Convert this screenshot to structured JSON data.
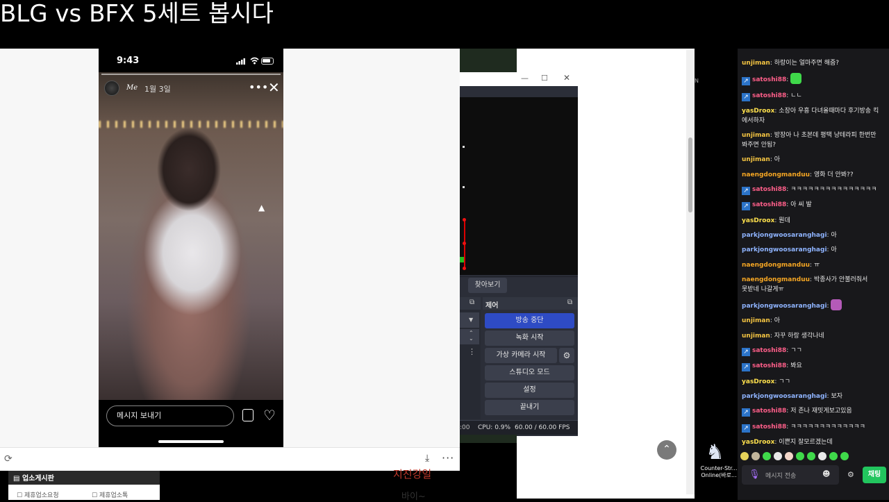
{
  "stream_title": "BLG vs BFX 5세트 봅시다",
  "phone": {
    "time": "9:43",
    "story_user": "Me",
    "story_date": "1월 3일",
    "message_placeholder": "메시지 보내기"
  },
  "browser_bottom": {
    "left_board_title": "업소게시판",
    "left_board_items": [
      "제휴업소요청",
      "제휴업소톡"
    ],
    "center_text_1": "지진강일",
    "center_text_2": "바이~"
  },
  "obs": {
    "find_label": "찾아보기",
    "controls_title": "제어",
    "buttons": {
      "stream": "방송 중단",
      "record": "녹화 시작",
      "virtual_cam": "가상 카메라 시작",
      "studio": "스튜디오 모드",
      "settings": "설정",
      "exit": "끝내기"
    },
    "status_time": ":00",
    "status_cpu": "CPU: 0.9%",
    "status_fps": "60.00 / 60.00 FPS"
  },
  "desktop_icon_label": "Counter-Str... Online(바로...",
  "chat": {
    "messages": [
      {
        "user": "unjiman",
        "color": "#f5c542",
        "text": "하랑이는 얼마주면 해줌?",
        "badge": false
      },
      {
        "user": "satoshi88",
        "color": "#ff5f8a",
        "text": "",
        "badge": true,
        "emote": "#3fd94a"
      },
      {
        "user": "satoshi88",
        "color": "#ff5f8a",
        "text": "ㄴㄴ",
        "badge": true
      },
      {
        "user": "yasDroox",
        "color": "#ffe14d",
        "text": "소장아 우흥 다녀올때마다 후기방송 킥 에서하자",
        "badge": false
      },
      {
        "user": "unjiman",
        "color": "#f5c542",
        "text": "방장아 나 초본데 평택 냥테라피 한번만 봐주면 안됨?",
        "badge": false
      },
      {
        "user": "unjiman",
        "color": "#f5c542",
        "text": "아",
        "badge": false
      },
      {
        "user": "naengdongmanduu",
        "color": "#f5a623",
        "text": "영화 더 안봐??",
        "badge": false
      },
      {
        "user": "satoshi88",
        "color": "#ff5f8a",
        "text": "ㅋㅋㅋㅋㅋㅋㅋㅋㅋㅋㅋㅋㅋㅋㅋ",
        "badge": true
      },
      {
        "user": "satoshi88",
        "color": "#ff5f8a",
        "text": "아 씨 발",
        "badge": true
      },
      {
        "user": "yasDroox",
        "color": "#ffe14d",
        "text": "뭔데",
        "badge": false
      },
      {
        "user": "parkjongwoosaranghagi",
        "color": "#8fb4ff",
        "text": "아",
        "badge": false
      },
      {
        "user": "parkjongwoosaranghagi",
        "color": "#8fb4ff",
        "text": "아",
        "badge": false
      },
      {
        "user": "naengdongmanduu",
        "color": "#f5a623",
        "text": "ㅠ",
        "badge": false
      },
      {
        "user": "naengdongmanduu",
        "color": "#f5a623",
        "text": "박종사가 안불러줘서 못받네 나갈게ㅠ",
        "badge": false
      },
      {
        "user": "parkjongwoosaranghagi",
        "color": "#8fb4ff",
        "text": "",
        "badge": false,
        "emote": "#b45ab8"
      },
      {
        "user": "unjiman",
        "color": "#f5c542",
        "text": "아",
        "badge": false
      },
      {
        "user": "unjiman",
        "color": "#f5c542",
        "text": "자꾸 하랑 생각나네",
        "badge": false
      },
      {
        "user": "satoshi88",
        "color": "#ff5f8a",
        "text": "ㄱㄱ",
        "badge": true
      },
      {
        "user": "satoshi88",
        "color": "#ff5f8a",
        "text": "봐요",
        "badge": true
      },
      {
        "user": "yasDroox",
        "color": "#ffe14d",
        "text": "ㄱㄱ",
        "badge": false
      },
      {
        "user": "parkjongwoosaranghagi",
        "color": "#8fb4ff",
        "text": "보자",
        "badge": false
      },
      {
        "user": "satoshi88",
        "color": "#ff5f8a",
        "text": "저 존나 재밋게보고있음",
        "badge": true
      },
      {
        "user": "satoshi88",
        "color": "#ff5f8a",
        "text": "ㅋㅋㅋㅋㅋㅋㅋㅋㅋㅋㅋㅋㅋ",
        "badge": true
      },
      {
        "user": "yasDroox",
        "color": "#ffe14d",
        "text": "이쁜지 잘모르겠는데",
        "badge": false
      }
    ],
    "input_placeholder": "메시지 전송",
    "send_label": "채팅",
    "emote_bar_colors": [
      "#e6d35a",
      "#c2b59b",
      "#3fd94a",
      "#e8e8e8",
      "#f2d5c8",
      "#3fd94a",
      "#3fd94a",
      "#e8e8e8",
      "#3fd94a",
      "#3fd94a"
    ]
  }
}
